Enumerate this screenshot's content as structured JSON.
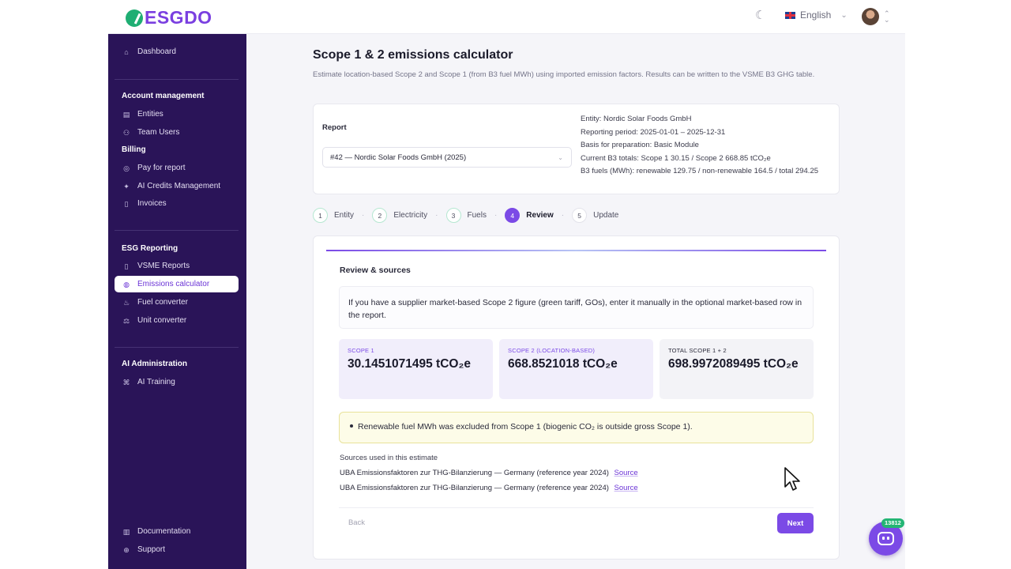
{
  "app": {
    "brand": "ESGDO",
    "language": "English"
  },
  "sidebar": {
    "dashboard": "Dashboard",
    "account_head": "Account management",
    "entities": "Entities",
    "team_users": "Team Users",
    "billing_head": "Billing",
    "pay_for_report": "Pay for report",
    "ai_credits": "AI Credits Management",
    "invoices": "Invoices",
    "esg_head": "ESG Reporting",
    "vsme_reports": "VSME Reports",
    "emissions_calculator": "Emissions calculator",
    "fuel_converter": "Fuel converter",
    "unit_converter": "Unit converter",
    "ai_admin_head": "AI Administration",
    "ai_training": "AI Training",
    "documentation": "Documentation",
    "support": "Support"
  },
  "main": {
    "title": "Scope 1 & 2 emissions calculator",
    "description": "Estimate location-based Scope 2 and Scope 1 (from B3 fuel MWh) using imported emission factors. Results can be written to the VSME B3 GHG table.",
    "report_label": "Report",
    "report_value": "#42 — Nordic Solar Foods GmbH (2025)",
    "meta": {
      "entity": "Entity: Nordic Solar Foods GmbH",
      "period": "Reporting period: 2025-01-01 – 2025-12-31",
      "basis": "Basis for preparation: Basic Module",
      "totals": "Current B3 totals: Scope 1 30.15 / Scope 2 668.85 tCO₂e",
      "fuels": "B3 fuels (MWh): renewable 129.75 / non-renewable 164.5 / total 294.25"
    },
    "steps": [
      {
        "num": "1",
        "label": "Entity"
      },
      {
        "num": "2",
        "label": "Electricity"
      },
      {
        "num": "3",
        "label": "Fuels"
      },
      {
        "num": "4",
        "label": "Review"
      },
      {
        "num": "5",
        "label": "Update"
      }
    ],
    "review": {
      "title": "Review & sources",
      "note": "If you have a supplier market-based Scope 2 figure (green tariff, GOs), enter it manually in the optional market-based row in the report.",
      "scope1_caption": "SCOPE 1",
      "scope1_value": "30.1451071495 tCO₂e",
      "scope2_caption": "SCOPE 2 (LOCATION-BASED)",
      "scope2_value": "668.8521018 tCO₂e",
      "total_caption": "TOTAL SCOPE 1 + 2",
      "total_value": "698.9972089495 tCO₂e",
      "warning": "Renewable fuel MWh was excluded from Scope 1 (biogenic CO₂ is outside gross Scope 1).",
      "sources_head": "Sources used in this estimate",
      "sources": [
        {
          "text": "UBA Emissionsfaktoren zur THG-Bilanzierung — Germany (reference year 2024)",
          "link": "Source"
        },
        {
          "text": "UBA Emissionsfaktoren zur THG-Bilanzierung — Germany (reference year 2024)",
          "link": "Source"
        }
      ],
      "back_label": "Back",
      "next_label": "Next"
    }
  },
  "bot": {
    "badge": "13812"
  },
  "colors": {
    "accent": "#7b4ae6",
    "sidebar": "#2a1458",
    "brand_green": "#1fae73"
  }
}
